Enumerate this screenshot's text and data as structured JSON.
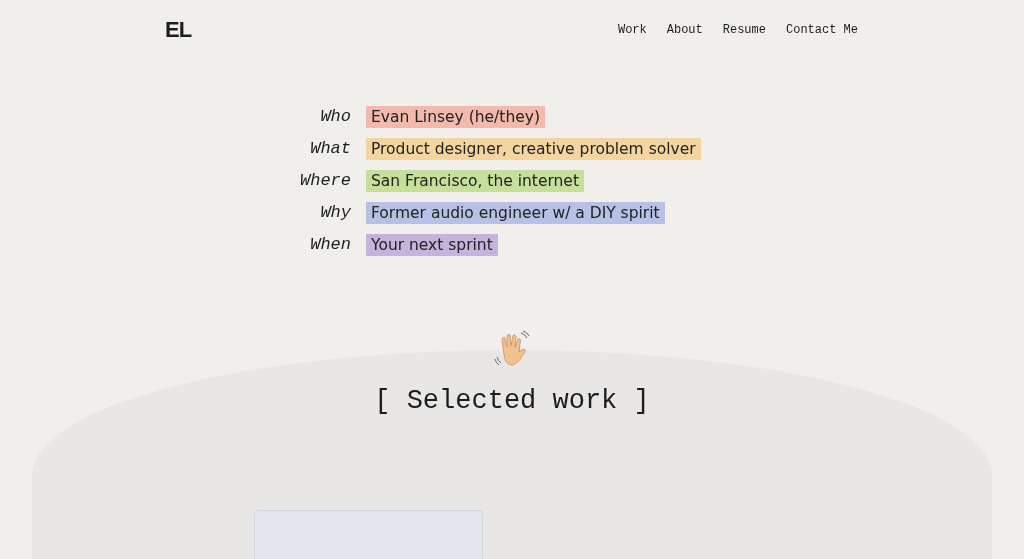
{
  "header": {
    "logo": "EL",
    "nav": [
      {
        "label": "Work"
      },
      {
        "label": "About"
      },
      {
        "label": "Resume"
      },
      {
        "label": "Contact Me"
      }
    ]
  },
  "intro": [
    {
      "label": "Who",
      "value": "Evan Linsey (he/they)",
      "color": "#f4b9ad"
    },
    {
      "label": "What",
      "value": "Product designer, creative problem solver",
      "color": "#f5d59f"
    },
    {
      "label": "Where",
      "value": "San Francisco, the internet",
      "color": "#c6e09b"
    },
    {
      "label": "Why",
      "value": "Former audio engineer w/ a DIY spirit",
      "color": "#b7c0e5"
    },
    {
      "label": "When",
      "value": "Your next sprint",
      "color": "#c5b2dd"
    }
  ],
  "section": {
    "heading": "[ Selected work ]"
  }
}
